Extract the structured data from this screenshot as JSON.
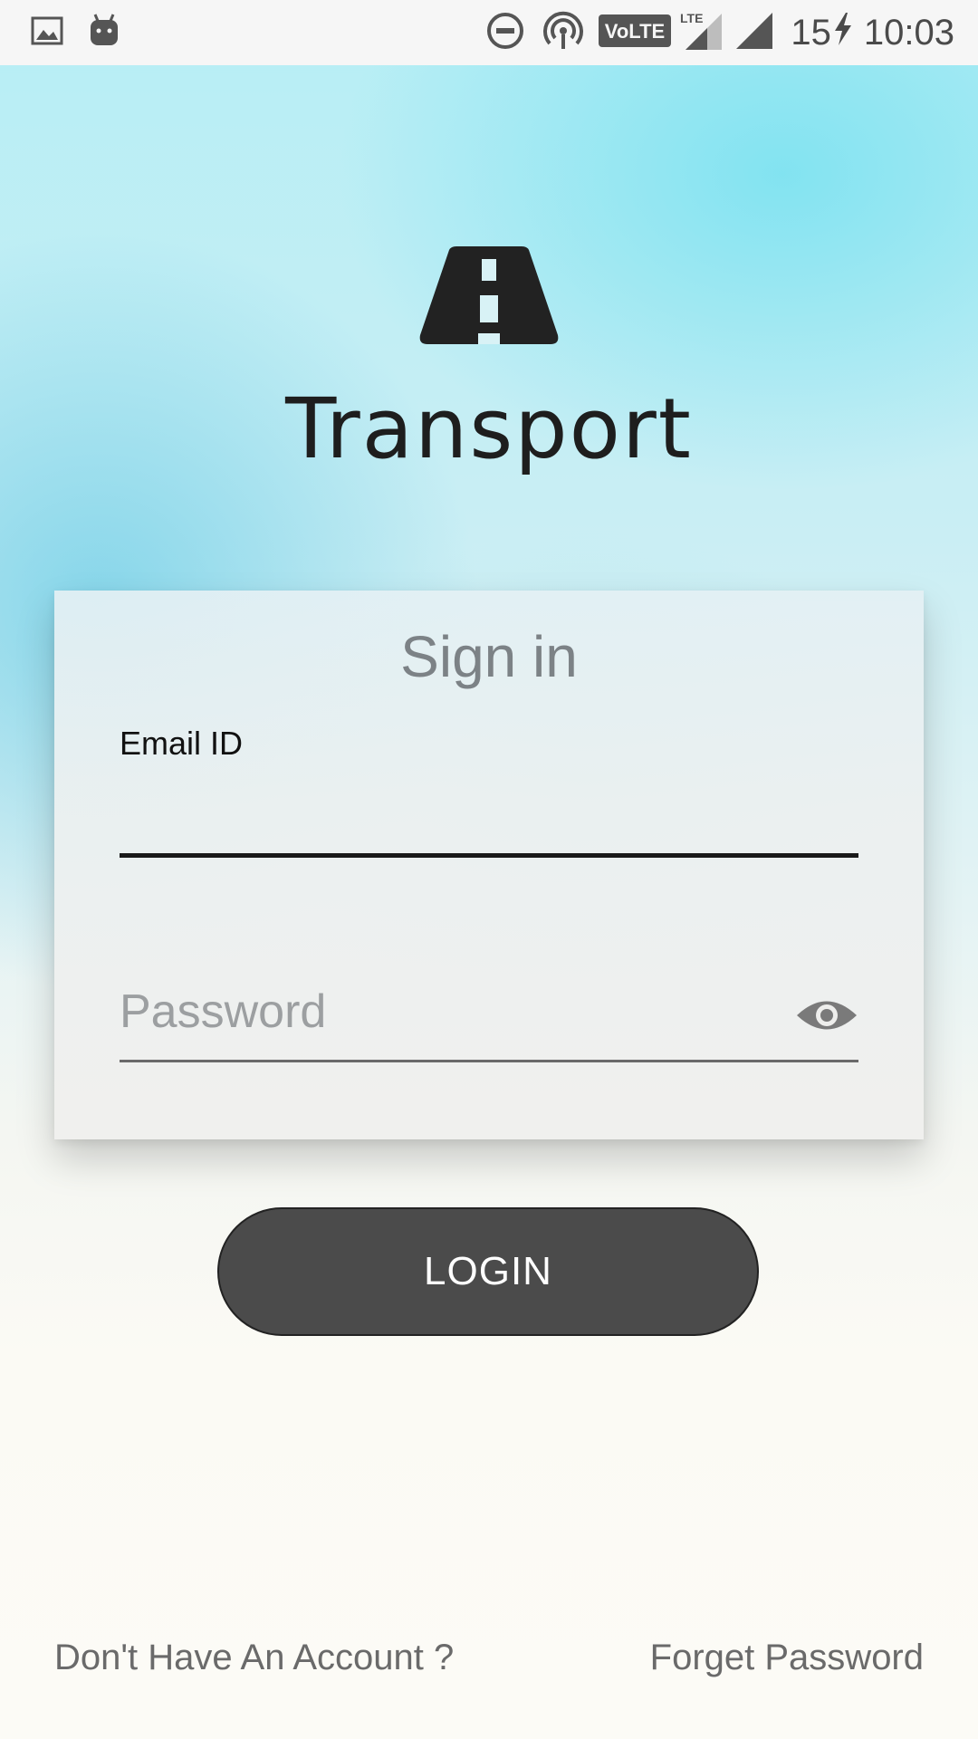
{
  "status_bar": {
    "left_icons": [
      "image-icon",
      "android-debug-icon"
    ],
    "right_icons": [
      "do-not-disturb-icon",
      "hotspot-icon",
      "volte-icon",
      "lte-signal-icon",
      "signal-icon"
    ],
    "volte_text": "VoLTE",
    "lte_text": "LTE",
    "battery_level": "15",
    "charging_icon": "bolt-icon",
    "time": "10:03"
  },
  "app": {
    "logo_icon": "road-icon",
    "title": "Transport"
  },
  "signin": {
    "title": "Sign in",
    "email_label": "Email ID",
    "email_value": "",
    "password_placeholder": "Password",
    "password_value": "",
    "password_toggle_icon": "eye-icon"
  },
  "actions": {
    "login_label": "LOGIN",
    "signup_link": "Don't Have An Account ?",
    "forgot_link": "Forget Password"
  },
  "colors": {
    "button_bg": "#4b4b4b",
    "text_dark": "#1e1e1e",
    "link_text": "#6a6a6a",
    "sky_accent": "#b6eef5"
  }
}
